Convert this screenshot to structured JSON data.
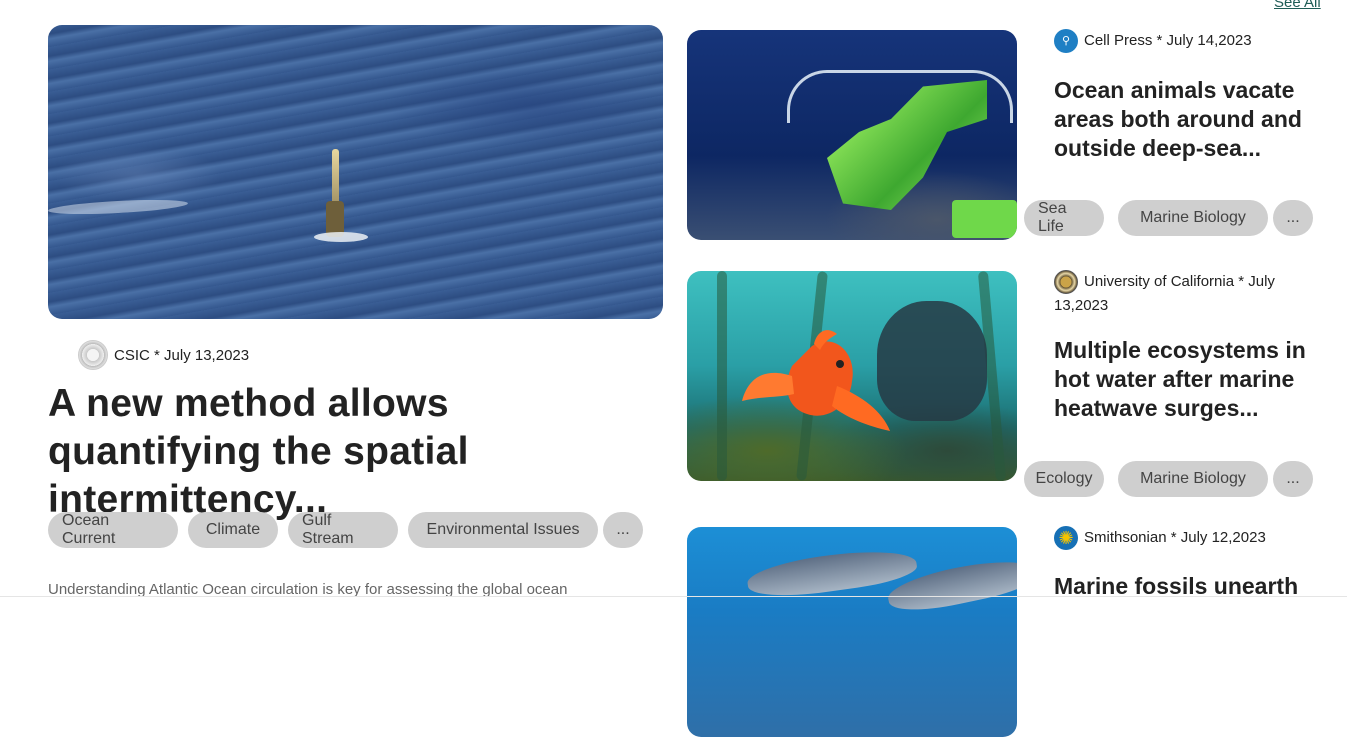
{
  "see_all": "See All",
  "featured": {
    "source": "CSIC",
    "date": "July 13,2023",
    "title": "A new method allows quantifying the spatial intermittency...",
    "tags": [
      "Ocean Current",
      "Climate",
      "Gulf Stream",
      "Environmental Issues",
      "..."
    ],
    "excerpt": "Understanding Atlantic Ocean circulation is key for assessing the global ocean"
  },
  "cards": [
    {
      "source": "Cell Press",
      "date": "July 14,2023",
      "title": "Ocean animals vacate areas both around and outside deep-sea...",
      "tags": [
        "Sea Life",
        "Marine Biology",
        "..."
      ],
      "icon": "cell-press-logo-icon"
    },
    {
      "source": "University of California",
      "date": "July 13,2023",
      "title": "Multiple ecosystems in hot water after marine heatwave surges...",
      "tags": [
        "Ecology",
        "Marine Biology",
        "..."
      ],
      "icon": "uc-seal-logo-icon"
    },
    {
      "source": "Smithsonian",
      "date": "July 12,2023",
      "title": "Marine fossils unearth",
      "tags": [],
      "icon": "smithsonian-sun-logo-icon"
    }
  ],
  "separator": " * ",
  "colors": {
    "tag_bg": "#cfcfcf",
    "link": "#1f5c56",
    "text": "#222222"
  }
}
